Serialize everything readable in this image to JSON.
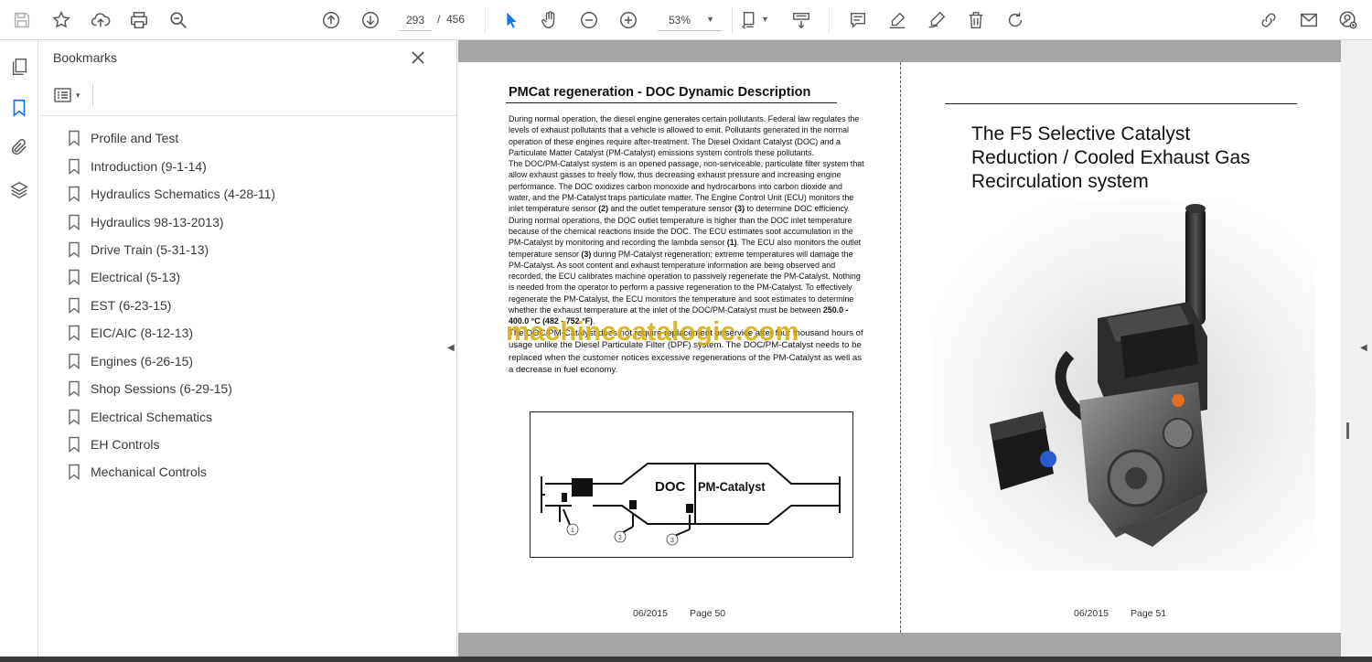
{
  "toolbar": {
    "page_current": "293",
    "page_sep": "/",
    "page_total": "456",
    "zoom": "53%",
    "icons_left": [
      "save-icon",
      "star-icon",
      "upload-icon",
      "print-icon",
      "zoom-search-icon"
    ],
    "icons_nav": [
      "page-up-icon",
      "page-down-icon"
    ],
    "icons_tools": [
      "select-arrow-icon",
      "hand-icon",
      "zoom-out-icon",
      "zoom-in-icon"
    ],
    "icons_right": [
      "fit-page-icon",
      "scroll-mode-icon",
      "comment-icon",
      "highlight-icon",
      "sign-icon",
      "delete-icon",
      "rotate-icon",
      "share-link-icon",
      "email-icon",
      "account-icon"
    ]
  },
  "rail": {
    "icons": [
      "pages-icon",
      "bookmark-icon",
      "attachment-icon",
      "layers-icon"
    ]
  },
  "bookmarks": {
    "title": "Bookmarks",
    "items": [
      "Profile and Test",
      "Introduction (9-1-14)",
      "Hydraulics Schematics (4-28-11)",
      "Hydraulics 98-13-2013)",
      "Drive Train (5-31-13)",
      "Electrical (5-13)",
      "EST (6-23-15)",
      "EIC/AIC (8-12-13)",
      "Engines (6-26-15)",
      "Shop Sessions (6-29-15)",
      "Electrical Schematics",
      "EH Controls",
      "Mechanical Controls"
    ]
  },
  "left_page": {
    "heading": "PMCat regeneration - DOC Dynamic Description",
    "para1": "During normal operation, the diesel engine generates certain pollutants. Federal law regulates the levels of exhaust pollutants that a vehicle is allowed to emit. Pollutants generated in the normal operation of these engines require after-treatment. The Diesel Oxidant Catalyst (DOC) and a Particulate Matter Catalyst (PM-Catalyst) emissions system controls these pollutants.",
    "para2a": "The DOC/PM-Catalyst system is an opened passage, non-serviceable, particulate filter system that allow exhaust gasses to freely flow, thus decreasing exhaust pressure and increasing engine performance. The DOC oxidizes carbon monoxide and hydrocarbons into carbon dioxide and water, and the PM-Catalyst traps particulate matter. The Engine Control Unit (ECU) monitors the inlet temperature sensor ",
    "n2": "(2)",
    "para2b": " and the outlet temperature sensor ",
    "n3": "(3)",
    "para2c": " to determine DOC efficiency. During normal operations, the DOC outlet temperature is higher than the DOC inlet temperature because of the chemical reactions inside the DOC. The ECU estimates soot accumulation in the PM-Catalyst by monitoring and recording the lambda sensor ",
    "n1": "(1)",
    "para2d": ". The ECU also monitors the outlet temperature sensor ",
    "n3b": "(3)",
    "para2e": " during PM-Catalyst regeneration; extreme temperatures will damage the PM-Catalyst. As soot content and exhaust temperature information are being observed and recorded, the ECU calibrates machine operation to passively regenerate the PM-Catalyst. Nothing is needed from the operator to perform a passive regeneration to the PM-Catalyst. To effectively regenerate the PM-Catalyst, the ECU monitors the temperature and soot estimates to determine whether the exhaust temperature at the inlet of the DOC/PM-Catalyst must be between ",
    "temp": "250.0 - 400.0 °C (482 - 752 °F)",
    "para2f": ".",
    "para3": "The DOC/PM-Catalyst does not require replacement or service after four thousand hours of usage unlike the Diesel Particulate Filter (DPF) system. The DOC/PM-Catalyst needs to be replaced when the customer notices excessive regenerations of the PM-Catalyst as well as a decrease in fuel economy.",
    "watermark": "machinecatalogic.com",
    "diagram": {
      "doc": "DOC",
      "pm": "PM-Catalyst",
      "c1": "1",
      "c2": "2",
      "c3": "3"
    },
    "footer_date": "06/2015",
    "footer_page": "Page 50"
  },
  "right_page": {
    "title": "The F5 Selective Catalyst Reduction / Cooled Exhaust Gas Recirculation system",
    "footer_date": "06/2015",
    "footer_page": "Page 51"
  }
}
